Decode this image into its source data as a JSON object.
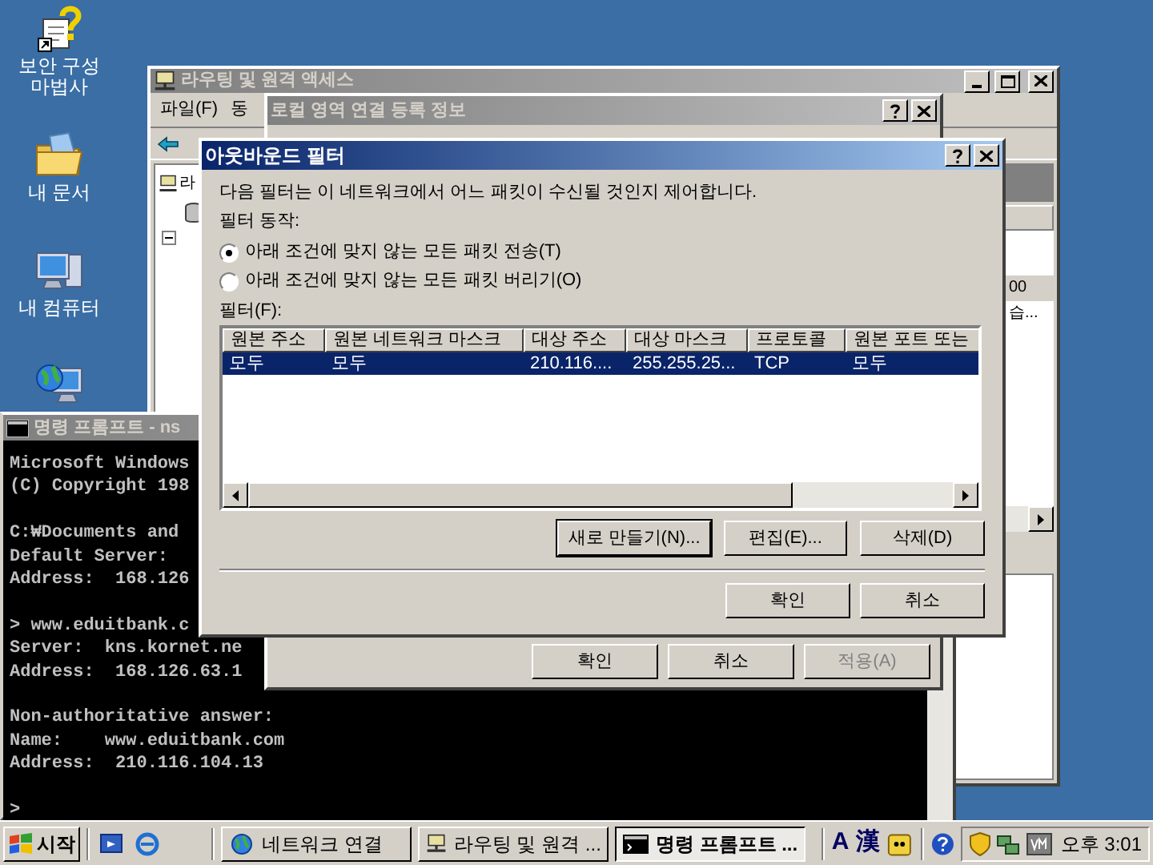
{
  "desktop_icons": [
    {
      "kind": "wizard",
      "label": "보안 구성 마법사"
    },
    {
      "kind": "documents",
      "label": "내 문서"
    },
    {
      "kind": "computer",
      "label": "내 컴퓨터"
    },
    {
      "kind": "network"
    }
  ],
  "routing_window": {
    "title": "라우팅 및 원격 액세스",
    "menu": [
      "파일(F)",
      "동"
    ],
    "tree_label": "라",
    "list_cells": [
      "00",
      "습..."
    ]
  },
  "console": {
    "title": "명령 프롬프트 - ns",
    "blocks": [
      [
        "Microsoft Windows",
        "(C) Copyright 198"
      ],
      [
        "C:₩Documents and",
        "Default Server:",
        "Address:  168.126"
      ],
      [
        "> www.eduitbank.c",
        "Server:  kns.kornet.ne",
        "Address:  168.126.63.1"
      ],
      [
        "Non-authoritative answer:",
        "Name:    www.eduitbank.com",
        "Address:  210.116.104.13"
      ],
      [
        ">"
      ]
    ]
  },
  "properties_dialog": {
    "title": "로컬 영역 연결 등록 정보",
    "buttons": [
      {
        "label": "확인",
        "disabled": false
      },
      {
        "label": "취소",
        "disabled": false
      },
      {
        "label": "적용(A)",
        "disabled": true
      }
    ]
  },
  "filter_dialog": {
    "title": "아웃바운드 필터",
    "description": "다음 필터는 이 네트워크에서 어느 패킷이 수신될 것인지 제어합니다.",
    "action_label": "필터 동작:",
    "actions": [
      {
        "label": "아래 조건에 맞지 않는 모든 패킷 전송(T)",
        "selected": true
      },
      {
        "label": "아래 조건에 맞지 않는 모든 패킷 버리기(O)",
        "selected": false
      }
    ],
    "filters_label": "필터(F):",
    "columns": [
      "원본 주소",
      "원본 네트워크 마스크",
      "대상 주소",
      "대상 마스크",
      "프로토콜",
      "원본 포트 또는"
    ],
    "rows": [
      {
        "cells": [
          "모두",
          "모두",
          "210.116....",
          "255.255.25...",
          "TCP",
          "모두"
        ],
        "selected": true
      }
    ],
    "list_buttons": [
      {
        "label": "새로 만들기(N)...",
        "default": true
      },
      {
        "label": "편집(E)...",
        "default": false
      },
      {
        "label": "삭제(D)",
        "default": false
      }
    ],
    "buttons": [
      "확인",
      "취소"
    ]
  },
  "taskbar": {
    "start": "시작",
    "tasks": [
      {
        "kind": "network",
        "label": "네트워크 연결",
        "selected": false
      },
      {
        "kind": "routing",
        "label": "라우팅 및 원격 ...",
        "selected": false
      },
      {
        "kind": "console",
        "label": "명령 프롬프트 ...",
        "selected": true
      }
    ],
    "language_bar": [
      "A",
      "漢"
    ],
    "clock": "오후 3:01"
  }
}
